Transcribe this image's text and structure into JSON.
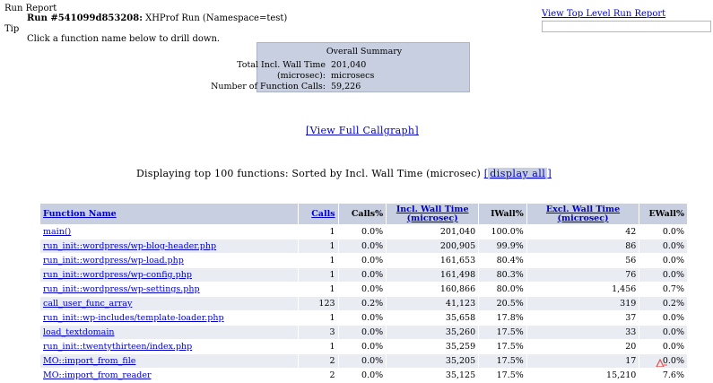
{
  "header": {
    "title": "Run Report",
    "run_label": "Run #541099d853208:",
    "run_desc": "XHProf Run (Namespace=test)",
    "tip_label": "Tip",
    "tip_text": "Click a function name below to drill down."
  },
  "top_link": "View Top Level Run Report",
  "summary": {
    "heading": "Overall Summary",
    "wall_label": "Total Incl. Wall Time",
    "wall_value": "201,040",
    "wall_unit_label": "(microsec):",
    "wall_unit": "microsecs",
    "calls_label": "Number of Function Calls:",
    "calls_value": "59,226"
  },
  "callgraph_link": "[View Full Callgraph]",
  "display": {
    "text": "Displaying top 100 functions: Sorted by Incl. Wall Time (microsec)",
    "bracket_open": "[",
    "link": "display all",
    "bracket_close": "]"
  },
  "table": {
    "headers": {
      "name": "Function Name",
      "calls": "Calls",
      "calls_pct": "Calls%",
      "incl_wall": "Incl. Wall Time (microsec)",
      "iwall_pct": "IWall%",
      "excl_wall": "Excl. Wall Time (microsec)",
      "ewall_pct": "EWall%"
    },
    "rows": [
      {
        "name": "main()",
        "calls": "1",
        "calls_pct": "0.0%",
        "incl": "201,040",
        "iwall": "100.0%",
        "excl": "42",
        "ewall": "0.0%"
      },
      {
        "name": "run_init::wordpress/wp-blog-header.php",
        "calls": "1",
        "calls_pct": "0.0%",
        "incl": "200,905",
        "iwall": "99.9%",
        "excl": "86",
        "ewall": "0.0%"
      },
      {
        "name": "run_init::wordpress/wp-load.php",
        "calls": "1",
        "calls_pct": "0.0%",
        "incl": "161,653",
        "iwall": "80.4%",
        "excl": "56",
        "ewall": "0.0%"
      },
      {
        "name": "run_init::wordpress/wp-config.php",
        "calls": "1",
        "calls_pct": "0.0%",
        "incl": "161,498",
        "iwall": "80.3%",
        "excl": "76",
        "ewall": "0.0%"
      },
      {
        "name": "run_init::wordpress/wp-settings.php",
        "calls": "1",
        "calls_pct": "0.0%",
        "incl": "160,866",
        "iwall": "80.0%",
        "excl": "1,456",
        "ewall": "0.7%"
      },
      {
        "name": "call_user_func_array",
        "calls": "123",
        "calls_pct": "0.2%",
        "incl": "41,123",
        "iwall": "20.5%",
        "excl": "319",
        "ewall": "0.2%"
      },
      {
        "name": "run_init::wp-includes/template-loader.php",
        "calls": "1",
        "calls_pct": "0.0%",
        "incl": "35,658",
        "iwall": "17.8%",
        "excl": "37",
        "ewall": "0.0%"
      },
      {
        "name": "load_textdomain",
        "calls": "3",
        "calls_pct": "0.0%",
        "incl": "35,260",
        "iwall": "17.5%",
        "excl": "33",
        "ewall": "0.0%"
      },
      {
        "name": "run_init::twentythirteen/index.php",
        "calls": "1",
        "calls_pct": "0.0%",
        "incl": "35,259",
        "iwall": "17.5%",
        "excl": "20",
        "ewall": "0.0%"
      },
      {
        "name": "MO::import_from_file",
        "calls": "2",
        "calls_pct": "0.0%",
        "incl": "35,205",
        "iwall": "17.5%",
        "excl": "17",
        "ewall": "0.0%"
      },
      {
        "name": "MO::import_from_reader",
        "calls": "2",
        "calls_pct": "0.0%",
        "incl": "35,125",
        "iwall": "17.5%",
        "excl": "15,210",
        "ewall": "7.6%"
      }
    ]
  },
  "colors": {
    "header_bg": "#c7cfe1",
    "row_alt_bg": "#e9ecf3",
    "link": "#0000cc"
  }
}
